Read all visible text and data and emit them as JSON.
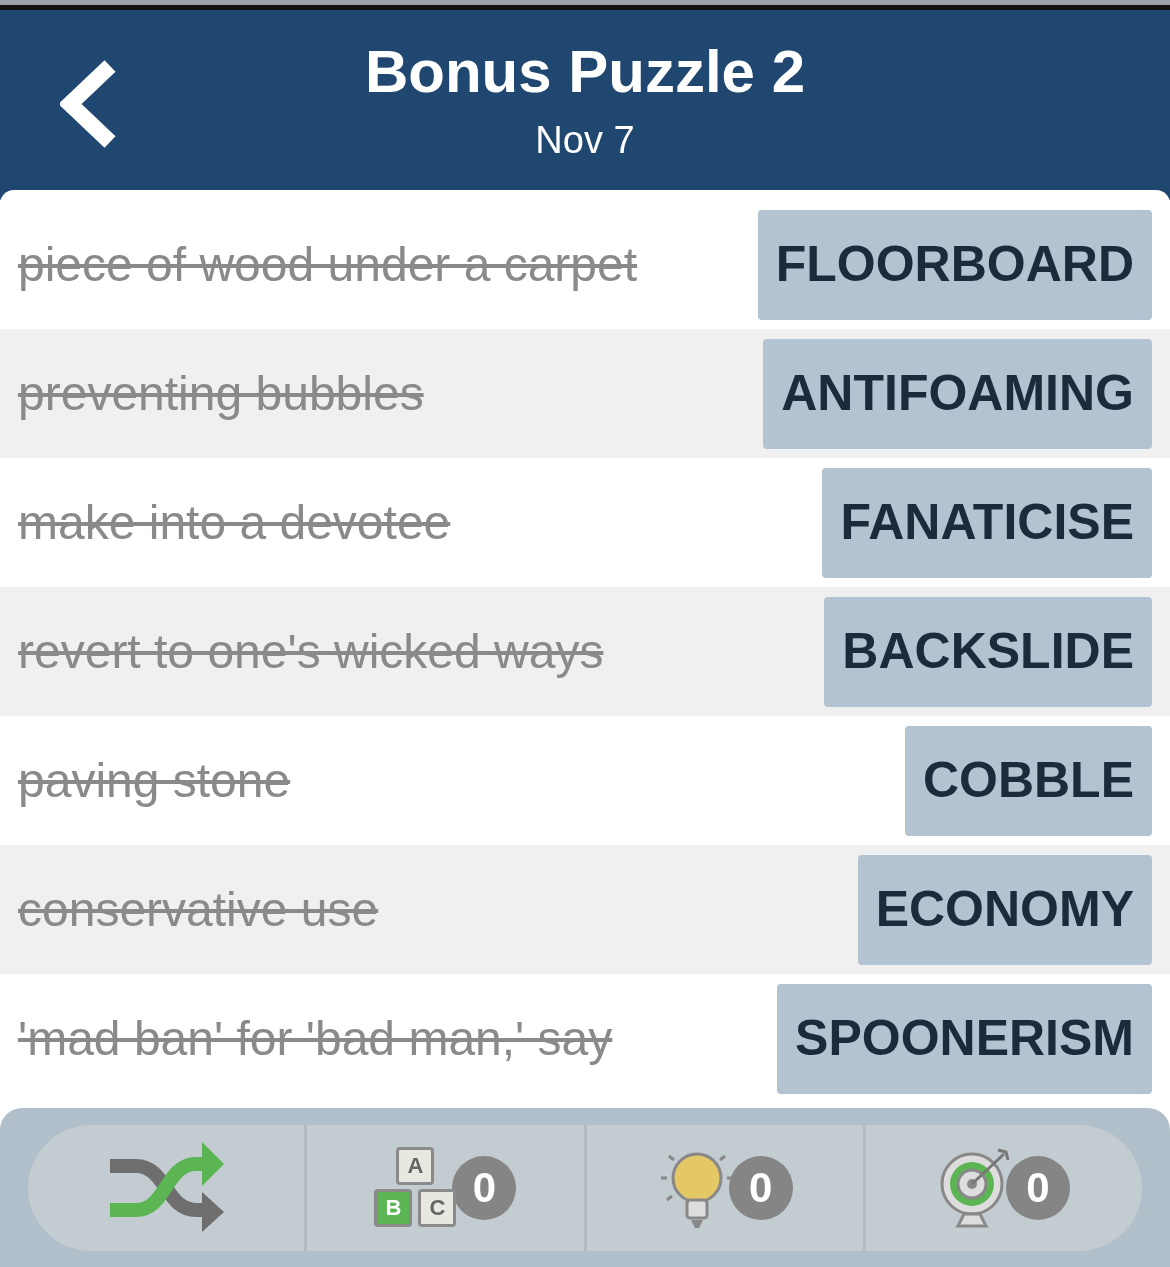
{
  "header": {
    "title": "Bonus Puzzle 2",
    "subtitle": "Nov 7"
  },
  "clues": [
    {
      "clue": "piece of wood under a carpet",
      "answer": "FLOORBOARD",
      "solved": true
    },
    {
      "clue": "preventing bubbles",
      "answer": "ANTIFOAMING",
      "solved": true
    },
    {
      "clue": "make into a devotee",
      "answer": "FANATICISE",
      "solved": true
    },
    {
      "clue": "revert to one's wicked ways",
      "answer": "BACKSLIDE",
      "solved": true
    },
    {
      "clue": "paving stone",
      "answer": "COBBLE",
      "solved": true
    },
    {
      "clue": "conservative use",
      "answer": "ECONOMY",
      "solved": true
    },
    {
      "clue": "'mad ban' for 'bad man,' say",
      "answer": "SPOONERISM",
      "solved": true
    }
  ],
  "toolbar": [
    {
      "kind": "shuffle"
    },
    {
      "kind": "letters",
      "letters": [
        "A",
        "B",
        "C"
      ],
      "count": "0"
    },
    {
      "kind": "hint",
      "count": "0"
    },
    {
      "kind": "target",
      "count": "0"
    }
  ]
}
